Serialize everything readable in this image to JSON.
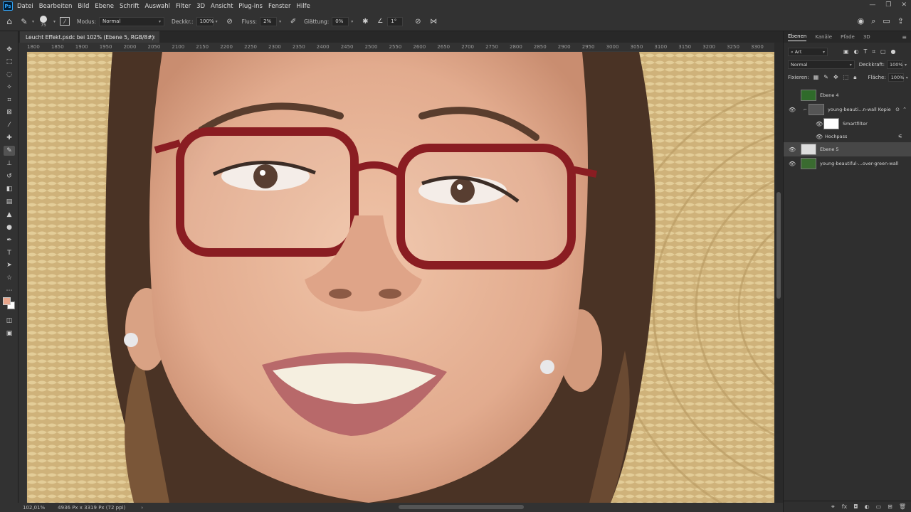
{
  "app": {
    "logo": "Ps"
  },
  "menu": [
    "Datei",
    "Bearbeiten",
    "Bild",
    "Ebene",
    "Schrift",
    "Auswahl",
    "Filter",
    "3D",
    "Ansicht",
    "Plug-ins",
    "Fenster",
    "Hilfe"
  ],
  "options": {
    "brush_size": "75",
    "mode_label": "Modus:",
    "mode_value": "Normal",
    "opacity_label": "Deckkr.:",
    "opacity_value": "100%",
    "flow_label": "Fluss:",
    "flow_value": "2%",
    "smoothing_label": "Glättung:",
    "smoothing_value": "0%",
    "angle_value": "1°"
  },
  "document": {
    "tab_title": "Leucht Effekt.psdc bei 102% (Ebene 5, RGB/8#)",
    "close": "×"
  },
  "ruler": {
    "labels": [
      "1800",
      "1850",
      "1900",
      "1950",
      "2000",
      "2050",
      "2100",
      "2150",
      "2200",
      "2250",
      "2300",
      "2350",
      "2400",
      "2450",
      "2500",
      "2550",
      "2600",
      "2650",
      "2700",
      "2750",
      "2800",
      "2850",
      "2900",
      "2950",
      "3000",
      "3050",
      "3100",
      "3150",
      "3200",
      "3250",
      "3300"
    ]
  },
  "status": {
    "zoom": "102,01%",
    "doc_info": "4936 Px x 3319 Px (72 ppi)",
    "arrow": "›"
  },
  "panel": {
    "tabs": [
      "Ebenen",
      "Kanäle",
      "Pfade",
      "3D"
    ],
    "filter_kind": "Art",
    "blend_mode": "Normal",
    "opacity_label": "Deckkraft:",
    "opacity_value": "100%",
    "lock_label": "Fixieren:",
    "fill_label": "Fläche:",
    "fill_value": "100%",
    "layers": [
      {
        "name": "Ebene 4",
        "visible": false,
        "selected": false
      },
      {
        "name": "young-beauti...n-wall Kopie",
        "visible": true,
        "selected": false
      },
      {
        "name": "Smartfilter",
        "visible": true,
        "selected": false
      },
      {
        "name": "Hochpass",
        "visible": true,
        "selected": false
      },
      {
        "name": "Ebene 5",
        "visible": true,
        "selected": true
      },
      {
        "name": "young-beautiful-...over-green-wall",
        "visible": true,
        "selected": false
      }
    ]
  },
  "colors": {
    "foreground": "#e8a58b",
    "background": "#ffffff"
  }
}
